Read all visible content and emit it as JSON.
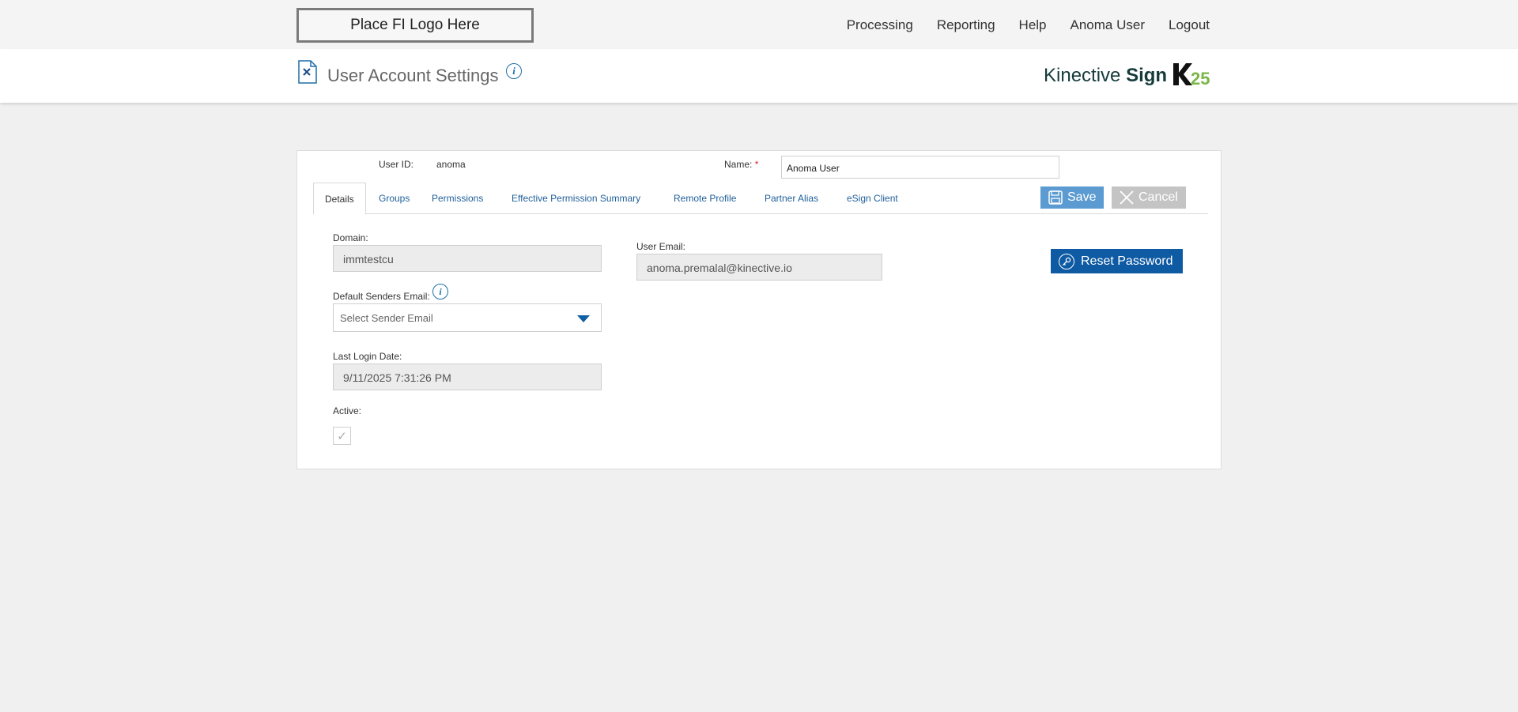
{
  "topbar": {
    "logo_placeholder": "Place FI Logo Here",
    "nav": [
      "Processing",
      "Reporting",
      "Help",
      "Anoma User",
      "Logout"
    ]
  },
  "header": {
    "title": "User Account Settings",
    "brand_regular": "Kinective ",
    "brand_bold": "Sign",
    "brand_mark": "K25"
  },
  "account": {
    "user_id_label": "User ID:",
    "user_id": "anoma",
    "name_label": "Name:",
    "name_required": "*",
    "name_value": "Anoma User"
  },
  "tabs": [
    "Details",
    "Groups",
    "Permissions",
    "Effective Permission Summary",
    "Remote Profile",
    "Partner Alias",
    "eSign Client"
  ],
  "actions": {
    "save": "Save",
    "cancel": "Cancel",
    "reset_password": "Reset Password"
  },
  "details": {
    "domain_label": "Domain:",
    "domain_value": "immtestcu",
    "default_senders_label": "Default Senders Email:",
    "default_senders_placeholder": "Select Sender Email",
    "last_login_label": "Last Login Date:",
    "last_login_value": "9/11/2025 7:31:26 PM",
    "active_label": "Active:",
    "active_checked": true,
    "user_email_label": "User Email:",
    "user_email_value": "anoma.premalal@kinective.io"
  },
  "colors": {
    "accent": "#0e5aa3",
    "save_button": "#5b9bd1",
    "cancel_button": "#c4c4c4",
    "brand_green": "#7ab648"
  }
}
